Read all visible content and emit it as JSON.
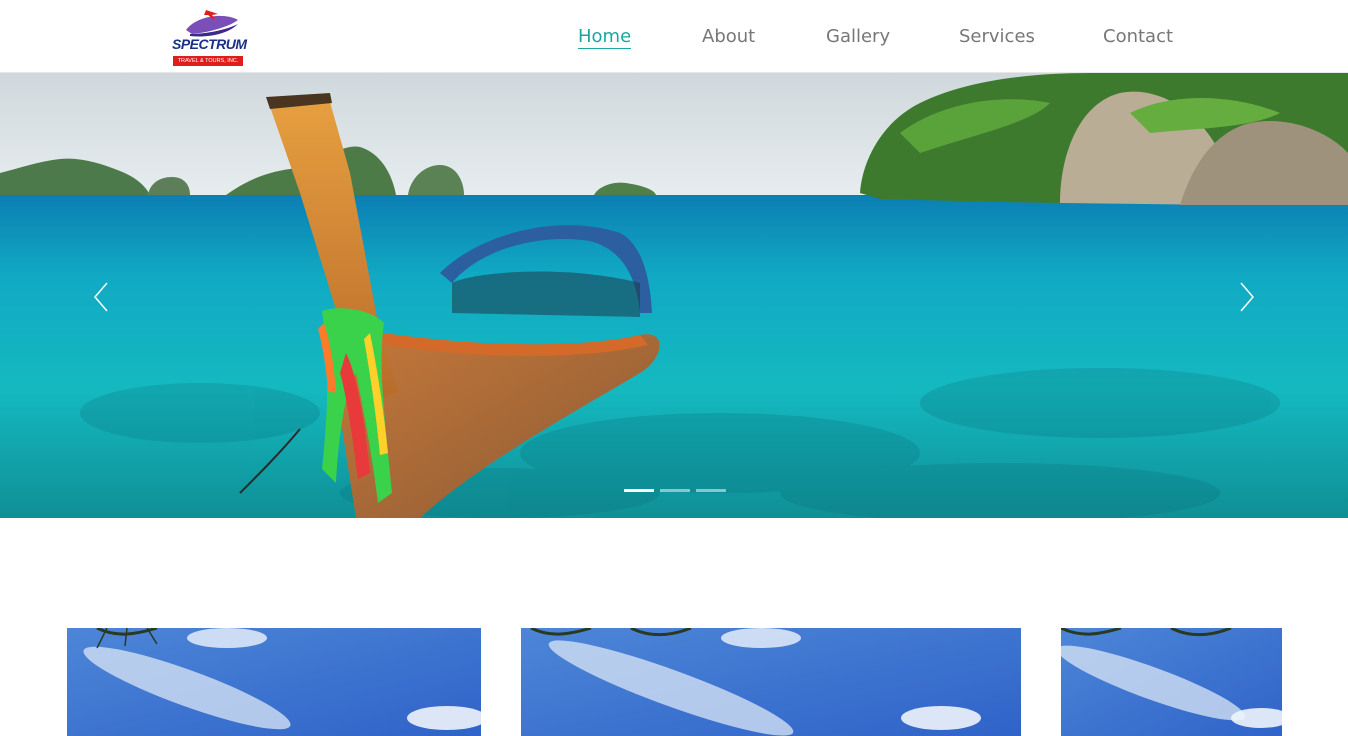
{
  "brand": {
    "name": "SPECTRUM",
    "tagline": "TRAVEL & TOURS, INC.",
    "colors": {
      "blue": "#1a2f8a",
      "red": "#e01d1d",
      "purple": "#7b4fb8"
    },
    "icon": "airplane-swoosh-logo"
  },
  "nav": {
    "items": [
      {
        "label": "Home",
        "active": true
      },
      {
        "label": "About",
        "active": false
      },
      {
        "label": "Gallery",
        "active": false
      },
      {
        "label": "Services",
        "active": false
      },
      {
        "label": "Contact",
        "active": false
      }
    ],
    "accent_color": "#19a7a0",
    "text_color": "#777777"
  },
  "hero": {
    "image": "longtail boat on turquoise sea with limestone islands",
    "prev_icon": "chevron-left-icon",
    "next_icon": "chevron-right-icon",
    "slide_count": 3,
    "active_slide": 1
  },
  "cards": [
    {
      "image": "blue sky with clouds and palm leaves"
    },
    {
      "image": "blue sky with clouds and palm leaves"
    },
    {
      "image": "blue sky with clouds and palm leaves"
    }
  ]
}
